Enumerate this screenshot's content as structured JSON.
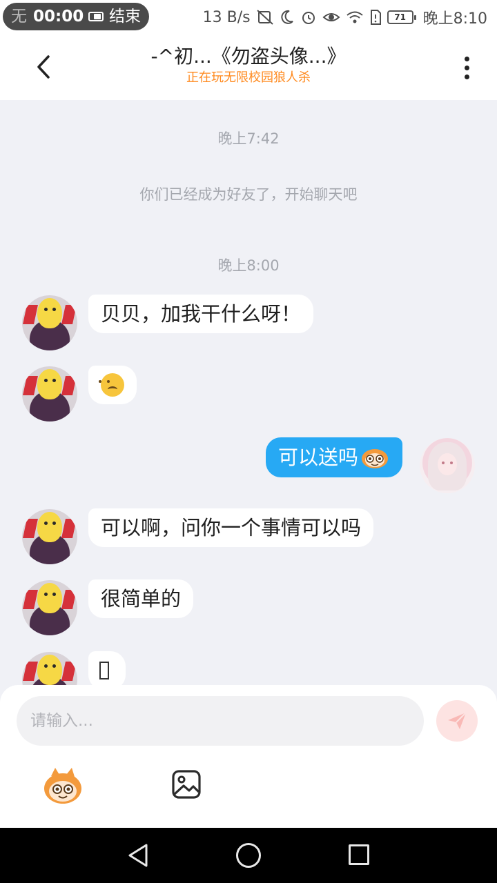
{
  "status_bar": {
    "recording_underlay": "无",
    "recording_time": "00:00",
    "recording_end": "结束",
    "net_speed": "13 B/s",
    "battery": "71",
    "time": "晚上8:10"
  },
  "header": {
    "title": "-^初...《勿盗头像...》",
    "subtitle": "正在玩无限校园狼人杀"
  },
  "chat": {
    "timestamps": [
      "晚上7:42",
      "晚上8:00"
    ],
    "system_note": "你们已经成为好友了，开始聊天吧",
    "messages": [
      {
        "side": "left",
        "text": "贝贝，加我干什么呀！"
      },
      {
        "side": "left",
        "emoji": "upside-down-face"
      },
      {
        "side": "right",
        "text": "可以送吗",
        "sticker": "mascot-sticker"
      },
      {
        "side": "left",
        "text": "可以啊，问你一个事情可以吗"
      },
      {
        "side": "left",
        "text": "很简单的"
      },
      {
        "side": "left",
        "glyph": "unrenderable-character"
      }
    ]
  },
  "input": {
    "placeholder": "请输入..."
  },
  "colors": {
    "accent_blue": "#27a9f4",
    "subtitle_orange": "#ff8a1f",
    "background": "#f0f1f6",
    "send_button_disabled": "#fde3e2"
  }
}
